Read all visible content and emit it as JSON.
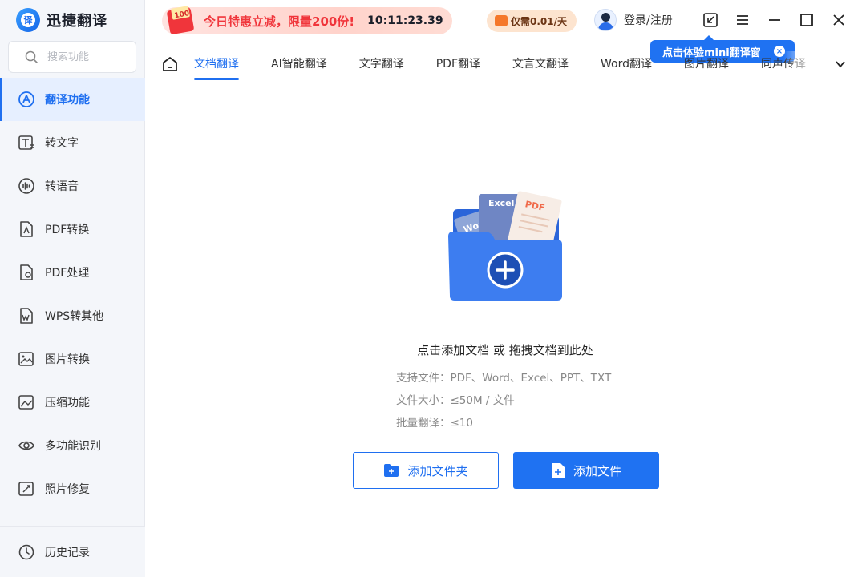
{
  "app": {
    "name": "迅捷翻译",
    "logo_glyph": "译"
  },
  "search": {
    "placeholder": "搜索功能"
  },
  "sidebar": {
    "items": [
      {
        "label": "翻译功能",
        "icon": "translate-icon",
        "active": true
      },
      {
        "label": "转文字",
        "icon": "text-convert-icon"
      },
      {
        "label": "转语音",
        "icon": "voice-icon"
      },
      {
        "label": "PDF转换",
        "icon": "pdf-convert-icon"
      },
      {
        "label": "PDF处理",
        "icon": "pdf-process-icon"
      },
      {
        "label": "WPS转其他",
        "icon": "wps-icon"
      },
      {
        "label": "图片转换",
        "icon": "image-convert-icon"
      },
      {
        "label": "压缩功能",
        "icon": "compress-icon"
      },
      {
        "label": "多功能识别",
        "icon": "eye-icon"
      },
      {
        "label": "照片修复",
        "icon": "photo-repair-icon"
      }
    ],
    "history_label": "历史记录"
  },
  "header": {
    "promo_badge": "100",
    "promo_text": "今日特惠立减，限量200份!",
    "promo_time": "10:11:23.39",
    "vip_text": "仅需0.01/天",
    "login_text": "登录/注册",
    "tooltip_text": "点击体验mini翻译窗",
    "tooltip_close": "×"
  },
  "tabs": [
    {
      "label": "文档翻译",
      "active": true
    },
    {
      "label": "AI智能翻译"
    },
    {
      "label": "文字翻译"
    },
    {
      "label": "PDF翻译"
    },
    {
      "label": "文言文翻译"
    },
    {
      "label": "Word翻译"
    },
    {
      "label": "图片翻译"
    },
    {
      "label": "同声传译"
    }
  ],
  "dropzone": {
    "doc_word": "Word",
    "doc_excel": "Excel",
    "doc_pdf": "PDF",
    "title": "点击添加文档 或 拖拽文档到此处",
    "formats": "支持文件：PDF、Word、Excel、PPT、TXT",
    "size": "文件大小：≤50M / 文件",
    "batch": "批量翻译：≤10",
    "add_folder_label": "添加文件夹",
    "add_file_label": "添加文件"
  },
  "colors": {
    "accent": "#1f6ff0",
    "promo": "#f0353b",
    "sidebar_bg": "#f4f6fa"
  }
}
